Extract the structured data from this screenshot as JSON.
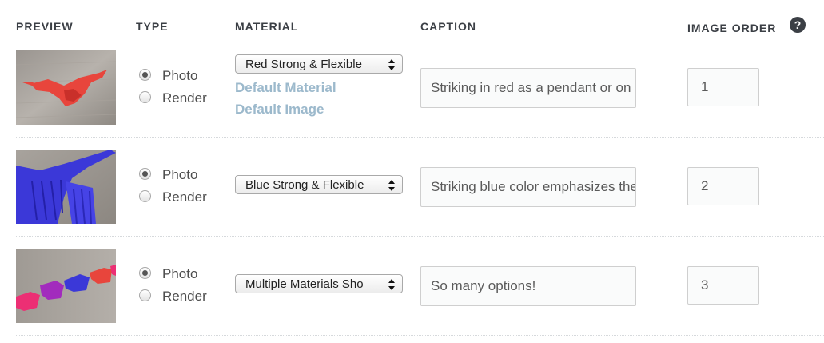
{
  "headers": {
    "preview": "PREVIEW",
    "type": "TYPE",
    "material": "MATERIAL",
    "caption": "CAPTION",
    "image_order": "IMAGE ORDER",
    "help_icon": "?"
  },
  "rows": [
    {
      "type_options": [
        "Photo",
        "Render"
      ],
      "type_selected": "Photo",
      "material": "Red Strong & Flexible",
      "links": [
        "Default Material",
        "Default Image"
      ],
      "caption": "Striking in red as a pendant or on a keychain",
      "order": "1",
      "preview_icon": "red-bird-thumbnail"
    },
    {
      "type_options": [
        "Photo",
        "Render"
      ],
      "type_selected": "Photo",
      "material": "Blue Strong & Flexible",
      "caption": "Striking blue color emphasizes the detail",
      "order": "2",
      "preview_icon": "blue-bird-thumbnail"
    },
    {
      "type_options": [
        "Photo",
        "Render"
      ],
      "type_selected": "Photo",
      "material": "Multiple Materials Sho",
      "caption": "So many options!",
      "order": "3",
      "preview_icon": "multicolor-birds-thumbnail"
    }
  ],
  "colors": {
    "header": "#3b3f45",
    "link": "#9cb9cc",
    "red": "#e8453c",
    "blue": "#3b38d8",
    "pink": "#ec2f74",
    "magenta": "#a22bbd"
  }
}
